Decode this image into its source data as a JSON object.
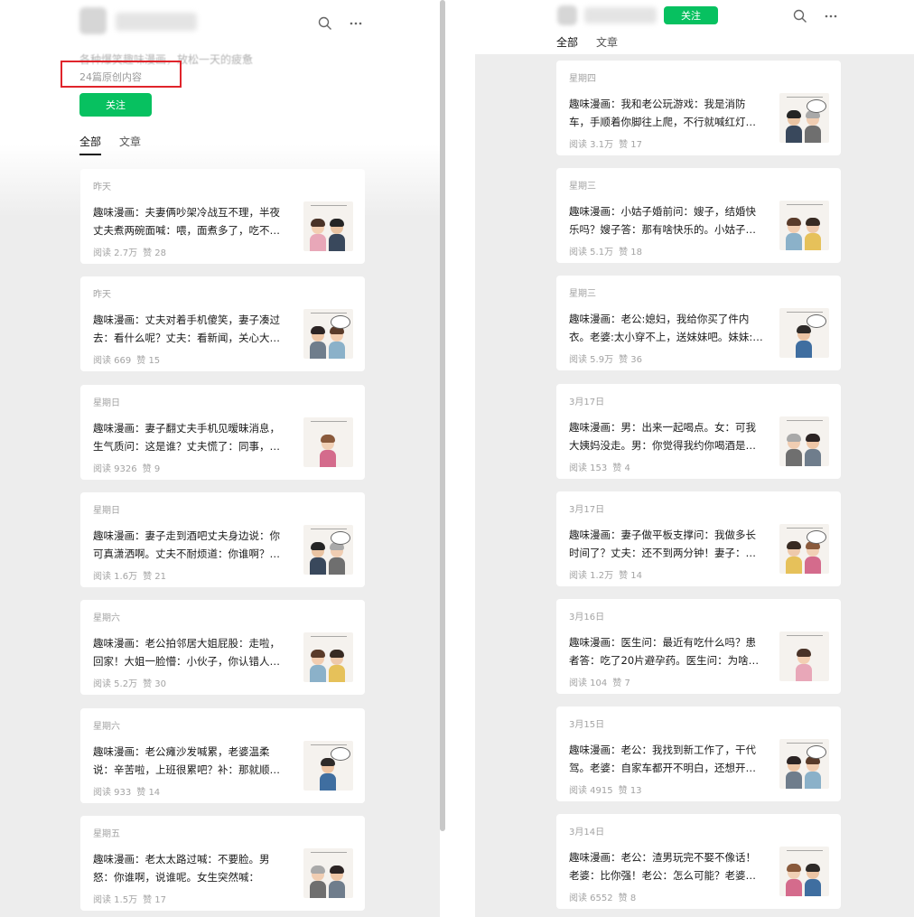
{
  "left": {
    "description": "各种爆笑趣味漫画，放松一天的疲惫",
    "article_count": "24篇原创内容",
    "follow_label": "关注",
    "tabs": [
      "全部",
      "文章"
    ],
    "articles": [
      {
        "date": "昨天",
        "title": "趣味漫画：夫妻俩吵架冷战互不理，半夜丈夫煮两碗面喊：喂，面煮多了，吃不…",
        "reads": "阅读 2.7万",
        "likes": "赞 28"
      },
      {
        "date": "昨天",
        "title": "趣味漫画：丈夫对着手机傻笑，妻子凑过去：看什么呢？丈夫：看新闻，关心大…",
        "reads": "阅读 669",
        "likes": "赞 15"
      },
      {
        "date": "星期日",
        "title": "趣味漫画：妻子翻丈夫手机见暧昧消息，生气质问：这是谁？丈夫慌了：同事，…",
        "reads": "阅读 9326",
        "likes": "赞 9"
      },
      {
        "date": "星期日",
        "title": "趣味漫画：妻子走到酒吧丈夫身边说：你可真潇洒啊。丈夫不耐烦道：你谁啊？…",
        "reads": "阅读 1.6万",
        "likes": "赞 21"
      },
      {
        "date": "星期六",
        "title": "趣味漫画：老公拍邻居大姐屁股：走啦，回家！大姐一脸懵：小伙子，你认错人…",
        "reads": "阅读 5.2万",
        "likes": "赞 30"
      },
      {
        "date": "星期六",
        "title": "趣味漫画：老公瘫沙发喊累，老婆温柔说：辛苦啦，上班很累吧？补：那就顺…",
        "reads": "阅读 933",
        "likes": "赞 14"
      },
      {
        "date": "星期五",
        "title": "趣味漫画：老太太路过喊：不要脸。男怒：你谁啊，说谁呢。女生突然喊：妈，…",
        "reads": "阅读 1.5万",
        "likes": "赞 17"
      }
    ]
  },
  "right": {
    "follow_label": "关注",
    "tabs": [
      "全部",
      "文章"
    ],
    "articles": [
      {
        "date": "星期四",
        "title": "趣味漫画：我和老公玩游戏：我是消防车，手顺着你脚往上爬，不行就喊红灯…",
        "reads": "阅读 3.1万",
        "likes": "赞 17"
      },
      {
        "date": "星期三",
        "title": "趣味漫画：小姑子婚前问：嫂子，结婚快乐吗？嫂子答：那有啥快乐的。小姑子…",
        "reads": "阅读 5.1万",
        "likes": "赞 18"
      },
      {
        "date": "星期三",
        "title": "趣味漫画：老公:媳妇，我给你买了件内衣。老婆:太小穿不上，送妹妹吧。妹妹:…",
        "reads": "阅读 5.9万",
        "likes": "赞 36"
      },
      {
        "date": "3月17日",
        "title": "趣味漫画：男：出来一起喝点。女：可我大姨妈没走。男：你觉得我约你喝酒是…",
        "reads": "阅读 153",
        "likes": "赞 4"
      },
      {
        "date": "3月17日",
        "title": "趣味漫画：妻子做平板支撑问：我做多长时间了？丈夫：还不到两分钟！妻子：…",
        "reads": "阅读 1.2万",
        "likes": "赞 14"
      },
      {
        "date": "3月16日",
        "title": "趣味漫画：医生问：最近有吃什么吗？患者答：吃了20片避孕药。医生问：为啥…",
        "reads": "阅读 104",
        "likes": "赞 7"
      },
      {
        "date": "3月15日",
        "title": "趣味漫画：老公：我找到新工作了，干代驾。老婆：自家车都开不明白，还想开…",
        "reads": "阅读 4915",
        "likes": "赞 13"
      },
      {
        "date": "3月14日",
        "title": "趣味漫画：老公：渣男玩完不娶不像话！老婆：比你强！老公：怎么可能？老婆…",
        "reads": "阅读 6552",
        "likes": "赞 8"
      }
    ]
  },
  "colors": {
    "accent": "#07c160",
    "annotation": "#e0242b"
  },
  "icons": {
    "search": "search-icon",
    "more": "more-icon"
  }
}
